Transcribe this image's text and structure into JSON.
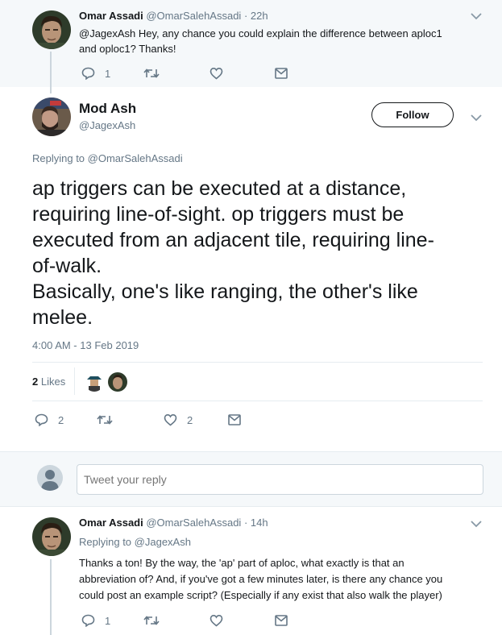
{
  "parent_tweet": {
    "author_name": "Omar Assadi",
    "author_handle": "@OmarSalehAssadi",
    "time": "· 22h",
    "text_line1": "@JagexAsh Hey, any chance you could explain the difference between aploc1",
    "text_line2": "and oploc1? Thanks!",
    "reply_count": "1",
    "retweet_count": "",
    "like_count": ""
  },
  "main_tweet": {
    "author_name": "Mod Ash",
    "author_handle": "@JagexAsh",
    "follow_label": "Follow",
    "replying_to_prefix": "Replying to ",
    "replying_to_handle": "@OmarSalehAssadi",
    "text_lines": [
      "ap triggers can be executed at a distance,",
      "requiring line-of-sight. op triggers must be",
      "executed from an adjacent tile, requiring line-",
      "of-walk.",
      "Basically, one's like ranging, the other's like",
      "melee."
    ],
    "timestamp": "4:00 AM - 13 Feb 2019",
    "likes_count": "2",
    "likes_label": "Likes",
    "reply_count": "2",
    "like_count": "2"
  },
  "reply_box": {
    "placeholder": "Tweet your reply"
  },
  "reply_tweet": {
    "author_name": "Omar Assadi",
    "author_handle": "@OmarSalehAssadi",
    "time": "· 14h",
    "replying_to_prefix": "Replying to ",
    "replying_to_handle": "@JagexAsh",
    "text_lines": [
      "Thanks a ton! By the way, the 'ap' part of aploc, what exactly is that an",
      "abbreviation of? And, if you've got a few minutes later, is there any chance you",
      "could post an example script? (Especially if any exist that also walk the player)"
    ],
    "reply_count": "1"
  },
  "icons": [
    "reply-icon",
    "retweet-icon",
    "like-icon",
    "message-icon",
    "chevron-down-icon"
  ],
  "colors": {
    "accent": "#1da1f2",
    "muted": "#657786",
    "text": "#14171a",
    "band": "#f5f8fa",
    "divider": "#e6ecf0"
  }
}
